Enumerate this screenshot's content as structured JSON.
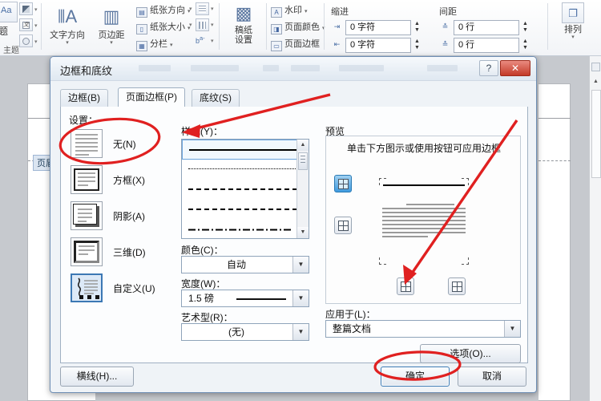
{
  "ribbon": {
    "group_theme_label": "主题",
    "text_direction": {
      "label": "文字方向",
      "icon": "text-direction-icon"
    },
    "page_margins": {
      "label": "页边距",
      "icon": "page-margins-icon"
    },
    "small_buttons": [
      {
        "label": "纸张方向",
        "icon": "paper-orientation-icon"
      },
      {
        "label": "纸张大小",
        "icon": "paper-size-icon"
      },
      {
        "label": "分栏",
        "icon": "columns-icon"
      }
    ],
    "grid_paper": {
      "line1": "稿纸",
      "line2": "设置",
      "icon": "grid-paper-icon"
    },
    "page_background": [
      {
        "label": "水印",
        "icon": "watermark-icon"
      },
      {
        "label": "页面颜色",
        "icon": "page-color-icon"
      },
      {
        "label": "页面边框",
        "icon": "page-border-icon"
      }
    ],
    "indent_label": "缩进",
    "spacing_label": "间距",
    "indent_left_value": "0 字符",
    "indent_right_value": "0 字符",
    "spacing_before_value": "0 行",
    "spacing_after_value": "0 行",
    "arrange": {
      "label": "排列",
      "icon": "arrange-icon"
    }
  },
  "document": {
    "header_tag": "页眉"
  },
  "dialog": {
    "title": "边框和底纹",
    "help_button": "?",
    "close_button": "✕",
    "tabs": [
      {
        "label": "边框(B)",
        "active": false
      },
      {
        "label": "页面边框(P)",
        "active": true
      },
      {
        "label": "底纹(S)",
        "active": false
      }
    ],
    "setting": {
      "label": "设置：",
      "items": [
        {
          "label": "无(N)",
          "selected": false,
          "thumb": "none-thumb"
        },
        {
          "label": "方框(X)",
          "selected": false,
          "thumb": "box-thumb"
        },
        {
          "label": "阴影(A)",
          "selected": false,
          "thumb": "shadow-thumb"
        },
        {
          "label": "三维(D)",
          "selected": false,
          "thumb": "three-d-thumb"
        },
        {
          "label": "自定义(U)",
          "selected": true,
          "thumb": "custom-thumb"
        }
      ]
    },
    "style": {
      "label": "样式(Y)：",
      "options": [
        {
          "kind": "solid",
          "selected": true
        },
        {
          "kind": "dotted",
          "selected": false
        },
        {
          "kind": "dashed-small",
          "selected": false
        },
        {
          "kind": "dashed",
          "selected": false
        },
        {
          "kind": "dash-dot",
          "selected": false
        }
      ]
    },
    "color": {
      "label": "颜色(C)：",
      "value": "自动"
    },
    "width": {
      "label": "宽度(W)：",
      "value": "1.5 磅"
    },
    "art": {
      "label": "艺术型(R)：",
      "value": "(无)"
    },
    "preview": {
      "label": "预览",
      "hint": "单击下方图示或使用按钮可应用边框",
      "buttons": [
        {
          "name": "top-border-toggle",
          "active": true
        },
        {
          "name": "bottom-border-toggle",
          "active": false
        },
        {
          "name": "left-border-toggle",
          "active": false
        },
        {
          "name": "right-border-toggle",
          "active": false
        }
      ]
    },
    "apply_to": {
      "label": "应用于(L)：",
      "value": "整篇文档"
    },
    "options_button": "选项(O)...",
    "horizontal_line_button": "横线(H)...",
    "ok_button": "确定",
    "cancel_button": "取消"
  },
  "annotations": {
    "color": "#e02020",
    "marks": [
      {
        "type": "ellipse",
        "target": "none-setting-option"
      },
      {
        "type": "arrow",
        "target": "style-list"
      },
      {
        "type": "arrow",
        "target": "bottom-left-preview-button"
      },
      {
        "type": "ellipse",
        "target": "ok-button"
      }
    ]
  }
}
